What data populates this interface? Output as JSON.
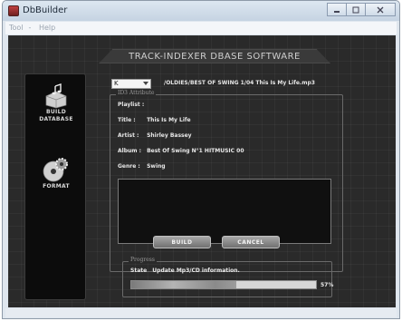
{
  "window": {
    "title": "DbBuilder"
  },
  "menu": [
    "Tool",
    "Help"
  ],
  "header": {
    "title": "TRACK-INDEXER DBASE SOFTWARE"
  },
  "sidebar": {
    "items": [
      {
        "label_line1": "BUILD",
        "label_line2": "DATABASE",
        "icon": "music-box-icon"
      },
      {
        "label_line1": "FORMAT",
        "label_line2": "",
        "icon": "disc-gear-icon"
      }
    ]
  },
  "drive": {
    "selected": "K"
  },
  "file_path": "/OLDIES/BEST OF SWING 1/04 This Is My Life.mp3",
  "id3": {
    "legend": "ID3 Attribute",
    "playlist_label": "Playlist :",
    "title_label": "Title :",
    "title_value": "This Is My Life",
    "artist_label": "Artist :",
    "artist_value": "Shirley Bassey",
    "album_label": "Album :",
    "album_value": "Best Of Swing N°1 HITMUSIC 00",
    "genre_label": "Genre :",
    "genre_value": "Swing"
  },
  "buttons": {
    "build": "BUILD",
    "cancel": "CANCEL"
  },
  "progress": {
    "legend": "Progress",
    "state_label": "State",
    "state_value": "Update Mp3/CD information.",
    "percent": 57,
    "percent_text": "57%"
  },
  "colors": {
    "app_background": "#2a2a2a",
    "sidebar": "#0c0c0c",
    "button": "#8c8c8c"
  }
}
